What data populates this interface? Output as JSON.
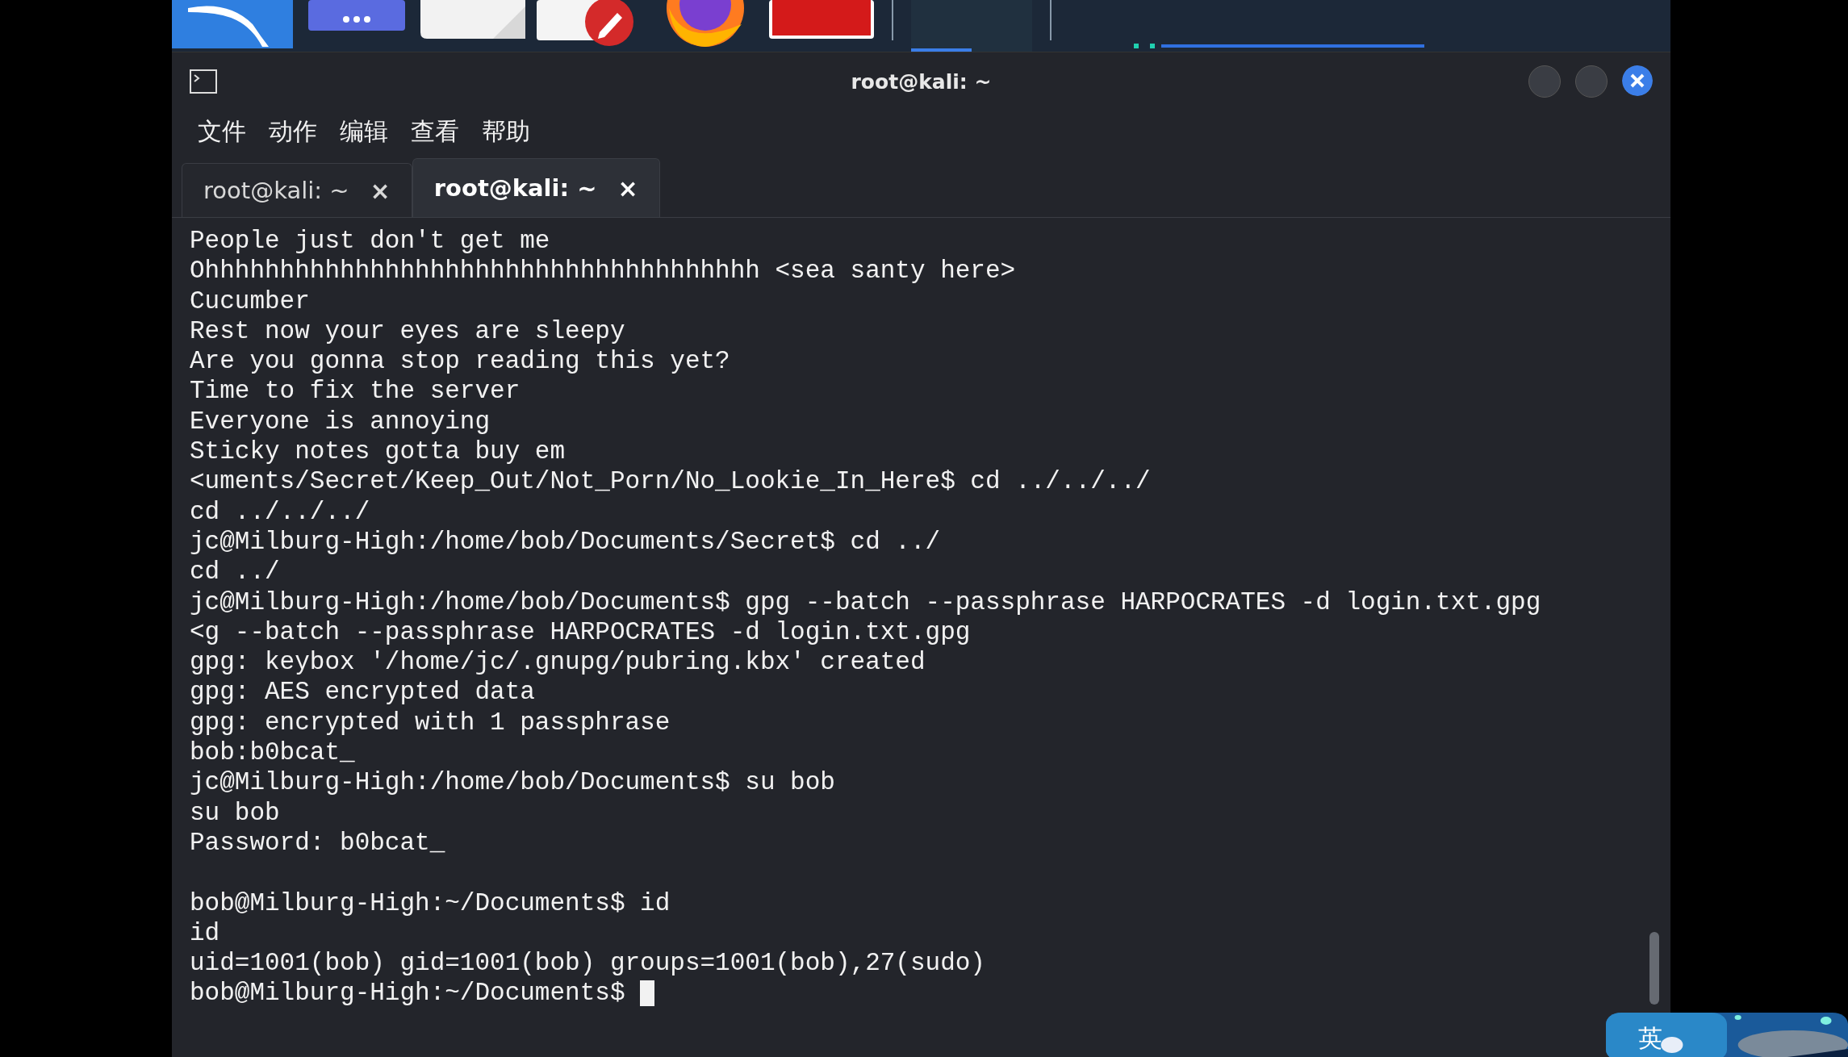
{
  "window": {
    "title": "root@kali: ~"
  },
  "menu": [
    "文件",
    "动作",
    "编辑",
    "查看",
    "帮助"
  ],
  "tabs": [
    {
      "label": "root@kali: ~",
      "close": "×",
      "selected": false
    },
    {
      "label": "root@kali: ~",
      "close": "×",
      "selected": true
    }
  ],
  "terminal_lines": [
    "People just don't get me",
    "Ohhhhhhhhhhhhhhhhhhhhhhhhhhhhhhhhhhhhh <sea santy here>",
    "Cucumber",
    "Rest now your eyes are sleepy",
    "Are you gonna stop reading this yet?",
    "Time to fix the server",
    "Everyone is annoying",
    "Sticky notes gotta buy em",
    "<uments/Secret/Keep_Out/Not_Porn/No_Lookie_In_Here$ cd ../../../",
    "cd ../../../",
    "jc@Milburg-High:/home/bob/Documents/Secret$ cd ../",
    "cd ../",
    "jc@Milburg-High:/home/bob/Documents$ gpg --batch --passphrase HARPOCRATES -d login.txt.gpg",
    "<g --batch --passphrase HARPOCRATES -d login.txt.gpg",
    "gpg: keybox '/home/jc/.gnupg/pubring.kbx' created",
    "gpg: AES encrypted data",
    "gpg: encrypted with 1 passphrase",
    "bob:b0bcat_",
    "jc@Milburg-High:/home/bob/Documents$ su bob",
    "su bob",
    "Password: b0bcat_"
  ],
  "terminal_lines_after_blank": [
    "bob@Milburg-High:~/Documents$ id",
    "id",
    "uid=1001(bob) gid=1001(bob) groups=1001(bob),27(sudo)"
  ],
  "prompt": "bob@Milburg-High:~/Documents$ ",
  "ime_indicator": "英"
}
